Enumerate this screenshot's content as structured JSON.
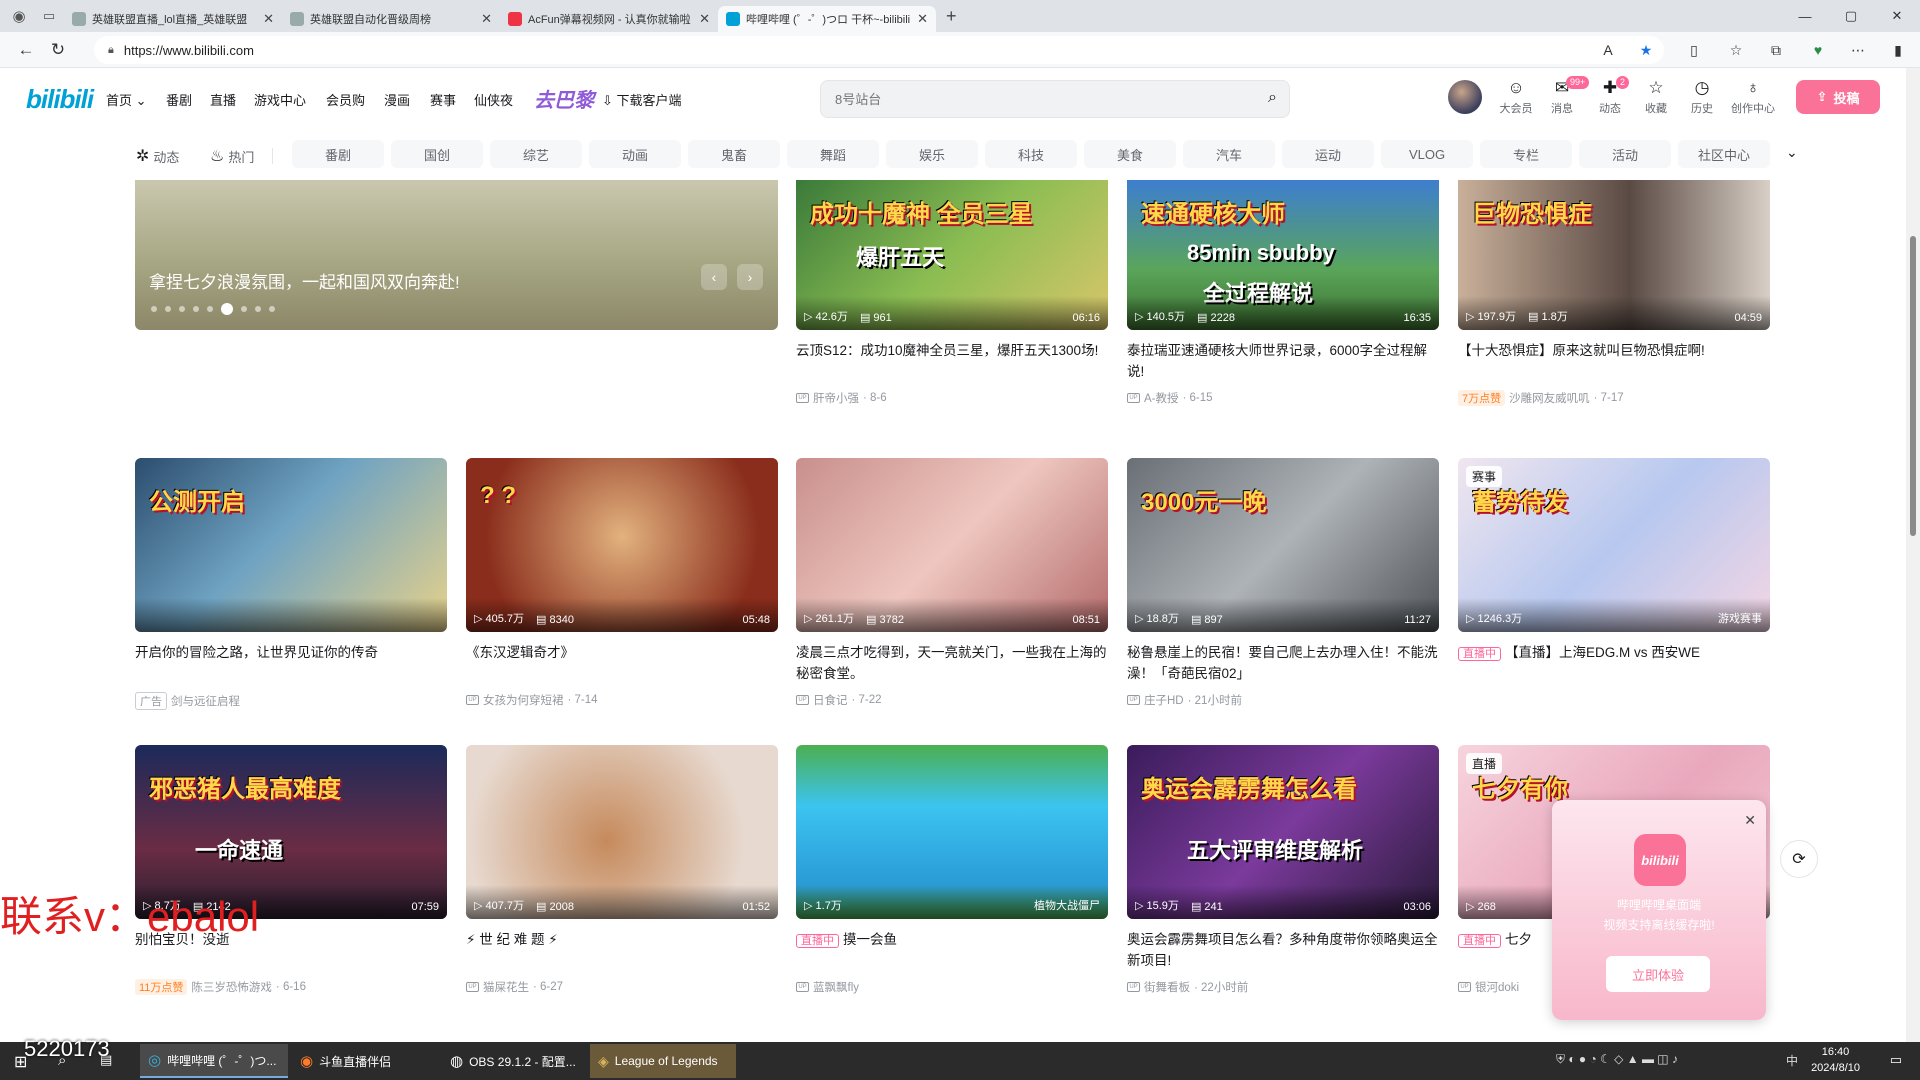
{
  "browser": {
    "tabs": [
      {
        "label": "英雄联盟直播_lol直播_英雄联盟",
        "color": "#9aa"
      },
      {
        "label": "英雄联盟自动化晋级周榜",
        "color": "#9aa"
      },
      {
        "label": "AcFun弹幕视频网 - 认真你就输啦",
        "color": "#e34"
      },
      {
        "label": "哔哩哔哩 (゜-゜)つロ 干杯~-bilibili",
        "color": "#00a1d6"
      }
    ],
    "url": "https://www.bilibili.com"
  },
  "header": {
    "logo": "bilibili",
    "nav": [
      "首页",
      "番剧",
      "直播",
      "游戏中心",
      "会员购",
      "漫画",
      "赛事",
      "仙侠夜",
      "去巴黎",
      "下载客户端"
    ],
    "search_placeholder": "8号站台",
    "icons": [
      {
        "label": "大会员",
        "glyph": "☺"
      },
      {
        "label": "消息",
        "glyph": "✉",
        "badge": "99+"
      },
      {
        "label": "动态",
        "glyph": "✚",
        "badge": "2"
      },
      {
        "label": "收藏",
        "glyph": "☆"
      },
      {
        "label": "历史",
        "glyph": "◷"
      },
      {
        "label": "创作中心",
        "glyph": "♁"
      }
    ],
    "upload_label": "投稿"
  },
  "channels": {
    "quick": [
      "动态",
      "热门"
    ],
    "items": [
      "番剧",
      "国创",
      "综艺",
      "动画",
      "鬼畜",
      "舞蹈",
      "娱乐",
      "科技",
      "美食",
      "汽车",
      "运动",
      "VLOG",
      "专栏",
      "活动",
      "社区中心"
    ]
  },
  "banner": {
    "caption": "拿捏七夕浪漫氛围，一起和国风双向奔赴!"
  },
  "videos": [
    {
      "title": "云顶S12：成功10魔神全员三星，爆肝五天1300场!",
      "views": "42.6万",
      "danmaku": "961",
      "duration": "06:16",
      "author": "肝帝小强",
      "date": "8-6",
      "thumb_text": "成功十魔神 全员三星",
      "thumb_text2": "爆肝五天",
      "bg": "linear-gradient(135deg,#3a7a3a,#8bbd52 50%,#d9c66b)"
    },
    {
      "title": "泰拉瑞亚速通硬核大师世界记录，6000字全过程解说!",
      "views": "140.5万",
      "danmaku": "2228",
      "duration": "16:35",
      "author": "A-教授",
      "date": "6-15",
      "thumb_text": "速通硬核大师",
      "thumb_text2": "85min  sbubby",
      "thumb_text3": "全过程解说",
      "bg": "linear-gradient(180deg,#3d7ed0,#5aa55a 60%,#3c6f2f)"
    },
    {
      "title": "【十大恐惧症】原来这就叫巨物恐惧症啊!",
      "views": "197.9万",
      "danmaku": "1.8万",
      "duration": "04:59",
      "author": "沙雕网友威叽叽",
      "date": "7-17",
      "hot": "7万点赞",
      "thumb_text": "巨物恐惧症",
      "bg": "linear-gradient(90deg,#c9b09a,#5a4a44 55%,#d8cfc6)"
    },
    {
      "title": "开启你的冒险之路，让世界见证你的传奇",
      "author": "剑与远征启程",
      "ad": "广告",
      "thumb_text": "公测开启",
      "bg": "linear-gradient(135deg,#2c4d6e,#6fa3c2 45%,#e8d28a)"
    },
    {
      "title": "《东汉逻辑奇才》",
      "views": "405.7万",
      "danmaku": "8340",
      "duration": "05:48",
      "author": "女孩为何穿短裙",
      "date": "7-14",
      "thumb_text": "? ?",
      "bg": "radial-gradient(circle at 50% 45%,#e2b27e,#8a2d1c 75%)"
    },
    {
      "title": "凌晨三点才吃得到，天一亮就关门，一些我在上海的秘密食堂。",
      "views": "261.1万",
      "danmaku": "3782",
      "duration": "08:51",
      "author": "日食记",
      "date": "7-22",
      "bg": "linear-gradient(135deg,#c98f8c,#efc7c0 50%,#b36a6a)"
    },
    {
      "title": "秘鲁悬崖上的民宿！要自己爬上去办理入住！不能洗澡！「奇葩民宿02」",
      "views": "18.8万",
      "danmaku": "897",
      "duration": "11:27",
      "author": "庄子HD",
      "date": "21小时前",
      "thumb_text": "3000元一晚",
      "bg": "linear-gradient(135deg,#6a6f75,#aeb3b8 50%,#4f5358)"
    },
    {
      "title": "【直播】上海EDG.M vs 西安WE",
      "views": "1246.3万",
      "author": "",
      "live": "直播中",
      "corner": "赛事",
      "thumb_text": "蓄势待发",
      "thumb_sub": "游戏赛事",
      "bg": "linear-gradient(135deg,#f0e6ef,#b7c8ef 50%,#f4d6e4)"
    },
    {
      "title": "别怕宝贝！没逝",
      "views": "8.7万",
      "danmaku": "2142",
      "duration": "07:59",
      "author": "陈三岁恐怖游戏",
      "date": "6-16",
      "hot": "11万点赞",
      "thumb_text": "邪恶猪人最高难度",
      "thumb_text2": "一命速通",
      "bg": "linear-gradient(180deg,#1c2a5a,#6a2c44 60%,#2a1f30)"
    },
    {
      "title": "⚡ 世 纪 难 题 ⚡",
      "views": "407.7万",
      "danmaku": "2008",
      "duration": "01:52",
      "author": "猫屎花生",
      "date": "6-27",
      "bg": "radial-gradient(circle at 45% 55%,#c68a5c,#e7d9cf 70%)"
    },
    {
      "title": "摸一会鱼",
      "views": "1.7万",
      "author": "蓝飘飘fly",
      "live": "直播中",
      "thumb_sub": "植物大战僵尸",
      "bg": "linear-gradient(180deg,#4caf50,#3cc4f0 35%,#2a9bd6 80%,#4caf50)"
    },
    {
      "title": "奥运会霹雳舞项目怎么看？多种角度带你领略奥运全新项目!",
      "views": "15.9万",
      "danmaku": "241",
      "duration": "03:06",
      "author": "街舞看板",
      "date": "22小时前",
      "thumb_text": "奥运会霹雳舞怎么看",
      "thumb_text2": "五大评审维度解析",
      "bg": "linear-gradient(135deg,#3a1c5a,#7b3a9c 50%,#2a1a3a)"
    },
    {
      "title": "七夕",
      "views": "268",
      "author": "银河doki",
      "live": "直播中",
      "corner": "直播",
      "thumb_text": "七夕有你",
      "bg": "linear-gradient(135deg,#f7d4de,#e9a8bd 55%,#f3c6d3)"
    }
  ],
  "popup": {
    "app_name": "bilibili",
    "line1": "哔哩哔哩桌面端",
    "line2": "视频支持离线缓存啦!",
    "button": "立即体验"
  },
  "overlay": {
    "watermark": "联系v：ebalol",
    "stream_id": "5220173"
  },
  "taskbar": {
    "apps": [
      "哔哩哔哩 (゜-゜)つ...",
      "斗鱼直播伴侣",
      "OBS 29.1.2 - 配置...",
      "League of Legends"
    ],
    "time": "16:40",
    "date": "2024/8/10",
    "ime": "中"
  }
}
